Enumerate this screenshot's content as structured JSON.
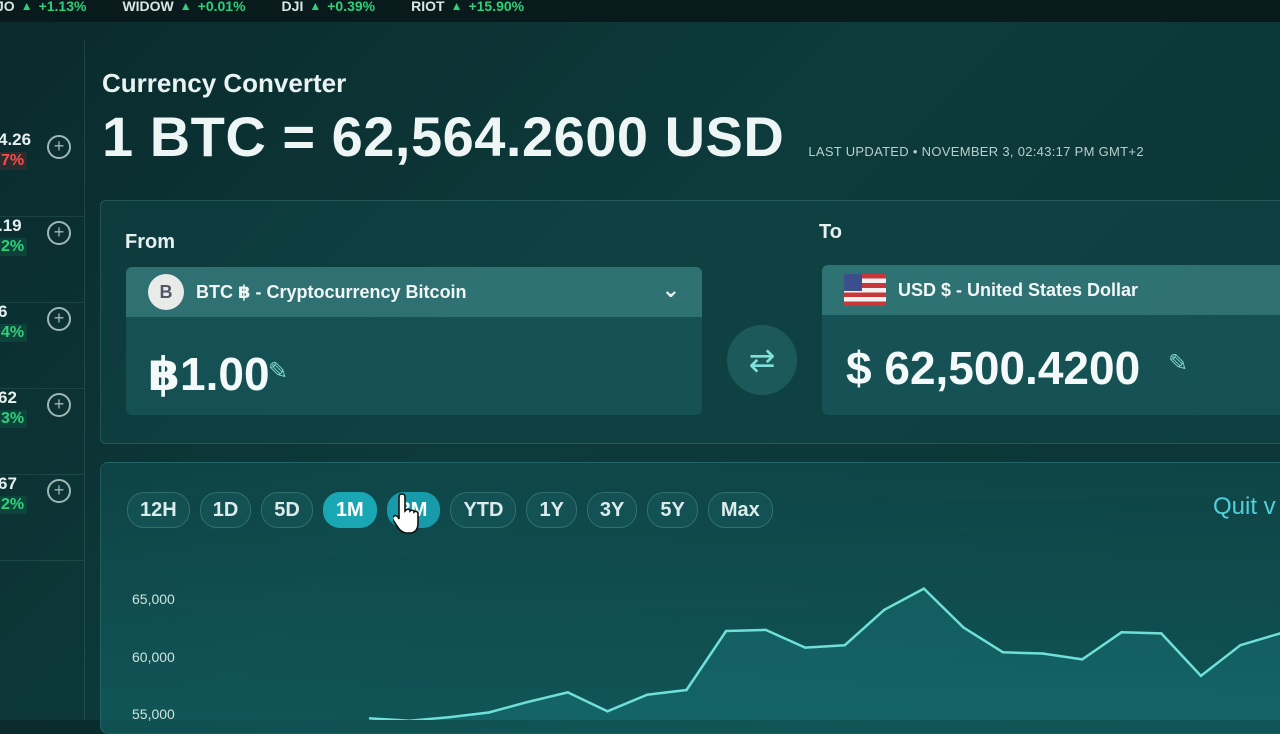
{
  "ticker": [
    {
      "symbol": "JO",
      "change": "+1.13%"
    },
    {
      "symbol": "WIDOW",
      "change": "+0.01%"
    },
    {
      "symbol": "DJI",
      "change": "+0.39%"
    },
    {
      "symbol": "RIOT",
      "change": "+15.90%"
    }
  ],
  "watchlist": [
    {
      "price": "4.26",
      "pct": "7%",
      "trend": "neg"
    },
    {
      "price": ".19",
      "pct": "2%",
      "trend": "pos"
    },
    {
      "price": "6",
      "pct": "4%",
      "trend": "pos"
    },
    {
      "price": "62",
      "pct": "3%",
      "trend": "pos"
    },
    {
      "price": "67",
      "pct": "2%",
      "trend": "pos"
    }
  ],
  "header": {
    "title": "Currency Converter",
    "rate": "1 BTC = 62,564.2600 USD",
    "last_updated": "LAST UPDATED • NOVEMBER 3, 02:43:17 PM GMT+2"
  },
  "converter": {
    "from_label": "From",
    "to_label": "To",
    "from_currency": "BTC ฿ - Cryptocurrency Bitcoin",
    "from_coin_symbol": "B",
    "from_amount": "฿1.00",
    "to_currency": "USD $ - United States Dollar",
    "to_amount": "$ 62,500.4200"
  },
  "ranges": [
    {
      "label": "12H",
      "state": ""
    },
    {
      "label": "1D",
      "state": ""
    },
    {
      "label": "5D",
      "state": ""
    },
    {
      "label": "1M",
      "state": "active"
    },
    {
      "label": "3M",
      "state": "hover"
    },
    {
      "label": "YTD",
      "state": ""
    },
    {
      "label": "1Y",
      "state": ""
    },
    {
      "label": "3Y",
      "state": ""
    },
    {
      "label": "5Y",
      "state": ""
    },
    {
      "label": "Max",
      "state": ""
    }
  ],
  "quit_text": "Quit v",
  "colors": {
    "accent": "#1aa7b4",
    "positive": "#2fd07a",
    "negative": "#ff4a4a"
  },
  "chart_data": {
    "type": "line",
    "y_ticks": [
      "65,000",
      "60,000",
      "55,000"
    ],
    "ylim": [
      52000,
      68000
    ],
    "values": [
      54800,
      54600,
      54900,
      55300,
      56200,
      57000,
      55400,
      56800,
      57200,
      62200,
      62300,
      60800,
      61000,
      64000,
      65800,
      62500,
      60400,
      60300,
      59800,
      62100,
      62000,
      58400,
      61000,
      62000
    ]
  }
}
